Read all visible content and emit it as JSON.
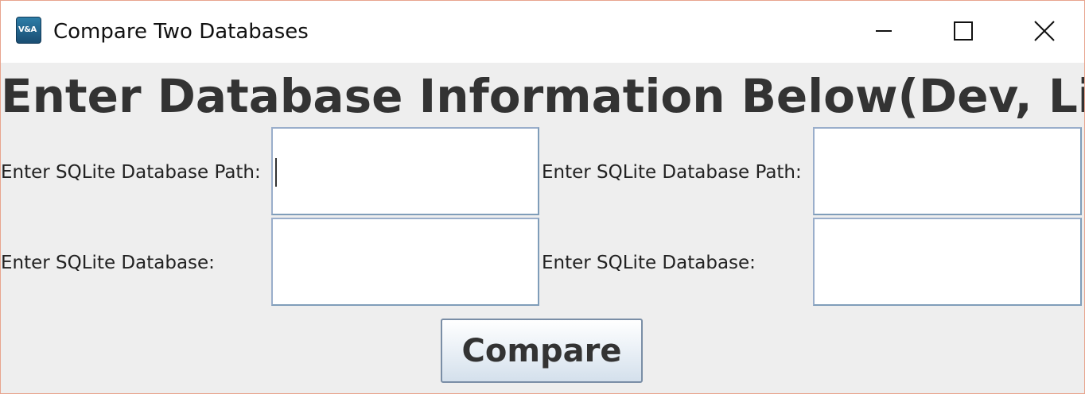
{
  "window": {
    "title": "Compare Two Databases",
    "icon_text": "V&A",
    "controls": {
      "minimize": "minimize-icon",
      "maximize": "maximize-icon",
      "close": "close-icon"
    },
    "border_color": "#e8a48e"
  },
  "main": {
    "heading": "Enter Database Information Below(Dev, Live)",
    "dev": {
      "path_label": "Enter SQLite Database Path:",
      "path_value": "",
      "db_label": "Enter SQLite Database:",
      "db_value": ""
    },
    "live": {
      "path_label": "Enter SQLite Database Path:",
      "path_value": "",
      "db_label": "Enter SQLite Database:",
      "db_value": ""
    },
    "compare_label": "Compare"
  }
}
